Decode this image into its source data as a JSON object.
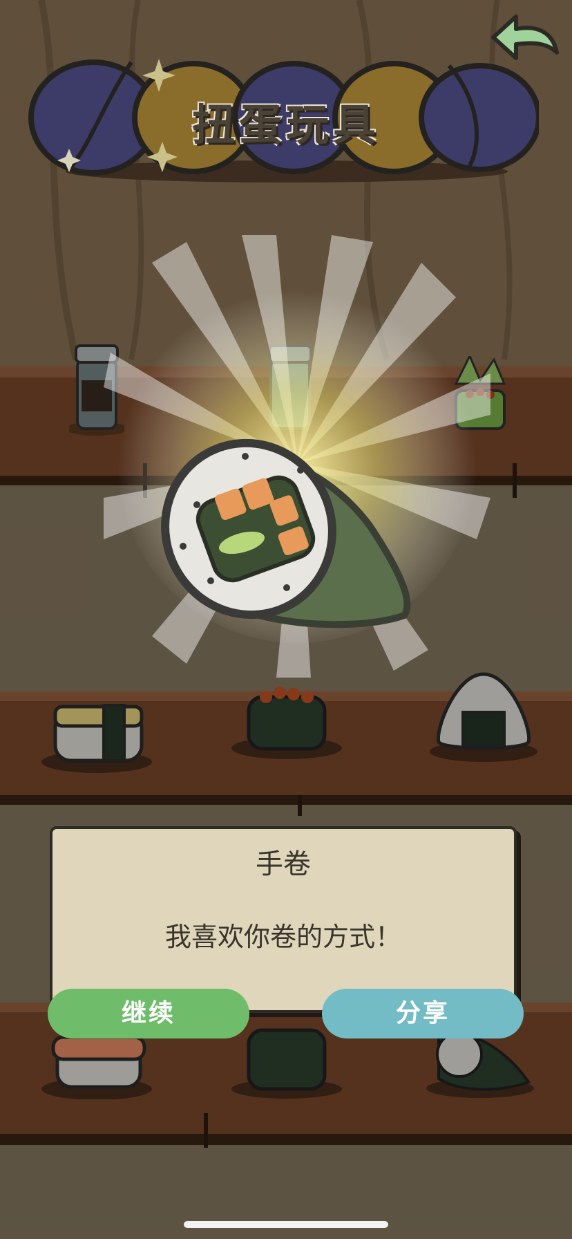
{
  "header": {
    "title": "扭蛋玩具"
  },
  "reward_dialog": {
    "item_name": "手卷",
    "message": "我喜欢你卷的方式！"
  },
  "buttons": {
    "continue_label": "继续",
    "share_label": "分享"
  },
  "icons": {
    "back": "back-arrow-icon",
    "hero": "hand-roll-icon"
  },
  "colors": {
    "continue": "#6fbd6b",
    "share": "#73bcc6",
    "dialog_bg": "#dfd6bb",
    "back_arrow": "#9fd39b"
  }
}
